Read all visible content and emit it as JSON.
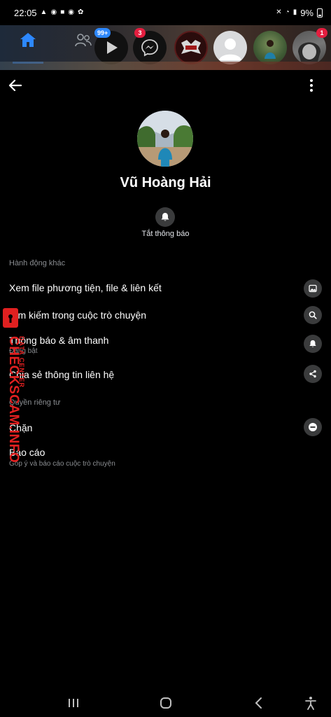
{
  "status_bar": {
    "time": "22:05",
    "battery": "9%"
  },
  "chat_heads": {
    "video_badge": "99+",
    "messenger_badge": "3",
    "last_badge": "1"
  },
  "profile": {
    "name": "Vũ Hoàng Hải",
    "mute_label": "Tắt thông báo"
  },
  "sections": [
    {
      "title": "Hành động khác",
      "items": [
        {
          "label": "Xem file phương tiện, file & liên kết",
          "icon": "image-icon"
        },
        {
          "label": "Tìm kiếm trong cuộc trò chuyện",
          "icon": "search-icon"
        },
        {
          "label": "Thông báo & âm thanh",
          "sub": "Đang bật",
          "icon": "bell-icon"
        },
        {
          "label": "Chia sẻ thông tin liên hệ",
          "icon": "share-icon"
        }
      ]
    },
    {
      "title": "Quyền riêng tư",
      "items": [
        {
          "label": "Chặn",
          "icon": "block-icon"
        },
        {
          "label": "Báo cáo",
          "sub": "Góp ý và báo cáo cuộc trò chuyện"
        }
      ]
    }
  ],
  "watermark": {
    "main": "CHECKSCAM.INFO",
    "side": "DATA CENTER"
  },
  "colors": {
    "accent": "#2d88ff",
    "badge_red": "#e41e3f",
    "icon_bg": "#3a3b3c",
    "watermark_red": "#e02020"
  }
}
